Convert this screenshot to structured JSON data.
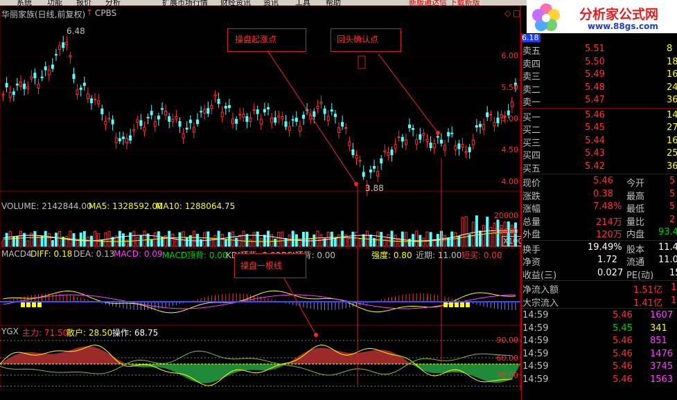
{
  "menu": {
    "items": [
      "系统",
      "功能",
      "报价",
      "分析",
      "扩展市场行情",
      "财经资讯",
      "资讯",
      "工具",
      "帮助"
    ],
    "notice": "新版通达信  下载新版"
  },
  "main_chart": {
    "header_title": "华丽家族(日线,前复权)",
    "header_indicator": "CPBS",
    "price_high_label": "6.48",
    "price_low_label": "3.88",
    "price_axis": [
      "6.00",
      "5.50",
      "5.00",
      "4.50",
      "4.00"
    ],
    "current_price_tag": "6.18"
  },
  "annotations": {
    "start": "操盘起涨点",
    "confirm": "回头确认点",
    "line": "操盘一根线"
  },
  "volume": {
    "label": "VOLUME: 2142844.00",
    "ma5": "MA5: 1328592.00",
    "ma10": "MA10: 1288064.75",
    "axis": [
      "20000",
      "10000"
    ],
    "unit": "X100"
  },
  "macd": {
    "name": "MACD4",
    "diff": "DIFF: 0.18",
    "dea": "DEA: 0.13",
    "macd": "MACD: 0.09",
    "top": "MACD顶背: 0.00",
    "kdj": "KDJ顶背: 0.00",
    "rsi": "RSI顶背: 0.00",
    "strength": "强度: 0.80",
    "recent": "近期: 11.00",
    "buy": "短买: 0.00"
  },
  "ygx": {
    "name": "YGX",
    "zhuli": "主力: 71.50",
    "sanhu": "散户: 28.50",
    "caozuo": "操作: 68.75",
    "axis": [
      "90.00",
      "60.00",
      "30.00"
    ]
  },
  "quote": {
    "sells": [
      {
        "label": "卖五",
        "price": "5.51",
        "vol": "8"
      },
      {
        "label": "卖四",
        "price": "5.50",
        "vol": "18"
      },
      {
        "label": "卖三",
        "price": "5.49",
        "vol": "16"
      },
      {
        "label": "卖二",
        "price": "5.48",
        "vol": "24"
      },
      {
        "label": "卖一",
        "price": "5.47",
        "vol": "36"
      }
    ],
    "buys": [
      {
        "label": "买一",
        "price": "5.46",
        "vol": "14"
      },
      {
        "label": "买二",
        "price": "5.45",
        "vol": "27"
      },
      {
        "label": "买三",
        "price": "5.44",
        "vol": "16"
      },
      {
        "label": "买四",
        "price": "5.43",
        "vol": "25"
      },
      {
        "label": "买五",
        "price": "5.42",
        "vol": "36"
      }
    ],
    "stats": [
      {
        "l1": "现价",
        "v1": "5.46",
        "l2": "今开",
        "v2": "5"
      },
      {
        "l1": "涨跌",
        "v1": "0.38",
        "l2": "最高",
        "v2": "5"
      },
      {
        "l1": "涨幅",
        "v1": "7.48%",
        "l2": "最低",
        "v2": "5"
      },
      {
        "l1": "总量",
        "v1": "214万",
        "l2": "量比",
        "v2": "2"
      },
      {
        "l1": "外盘",
        "v1": "120万",
        "l2": "内盘",
        "v2": "93.4"
      }
    ],
    "stats2": [
      {
        "l1": "换手",
        "v1": "19.49%",
        "l2": "股本",
        "v2": "11.4"
      },
      {
        "l1": "净资",
        "v1": "1.72",
        "l2": "流通",
        "v2": "11.0"
      },
      {
        "l1": "收益(三)",
        "v1": "0.027",
        "l2": "PE(动)",
        "v2": "15"
      }
    ],
    "flows": [
      {
        "l": "净流入额",
        "v": "1.51亿",
        "v2": "1"
      },
      {
        "l": "大宗流入",
        "v": "1.41亿",
        "v2": "1"
      }
    ],
    "ticks": [
      {
        "t": "14:59",
        "p": "5.46",
        "v": "1607"
      },
      {
        "t": "14:59",
        "p": "5.45",
        "v": "341"
      },
      {
        "t": "14:59",
        "p": "5.46",
        "v": "851"
      },
      {
        "t": "14:59",
        "p": "5.46",
        "v": "1476"
      },
      {
        "t": "14:59",
        "p": "5.46",
        "v": "3745"
      },
      {
        "t": "14:59",
        "p": "5.46",
        "v": "1563"
      }
    ]
  },
  "logo": {
    "text": "分析家公式网",
    "url": "www.88gs.com"
  },
  "colors": {
    "up": "#ff3232",
    "down": "#54ffff",
    "bg": "#000000",
    "grid": "#800000"
  }
}
